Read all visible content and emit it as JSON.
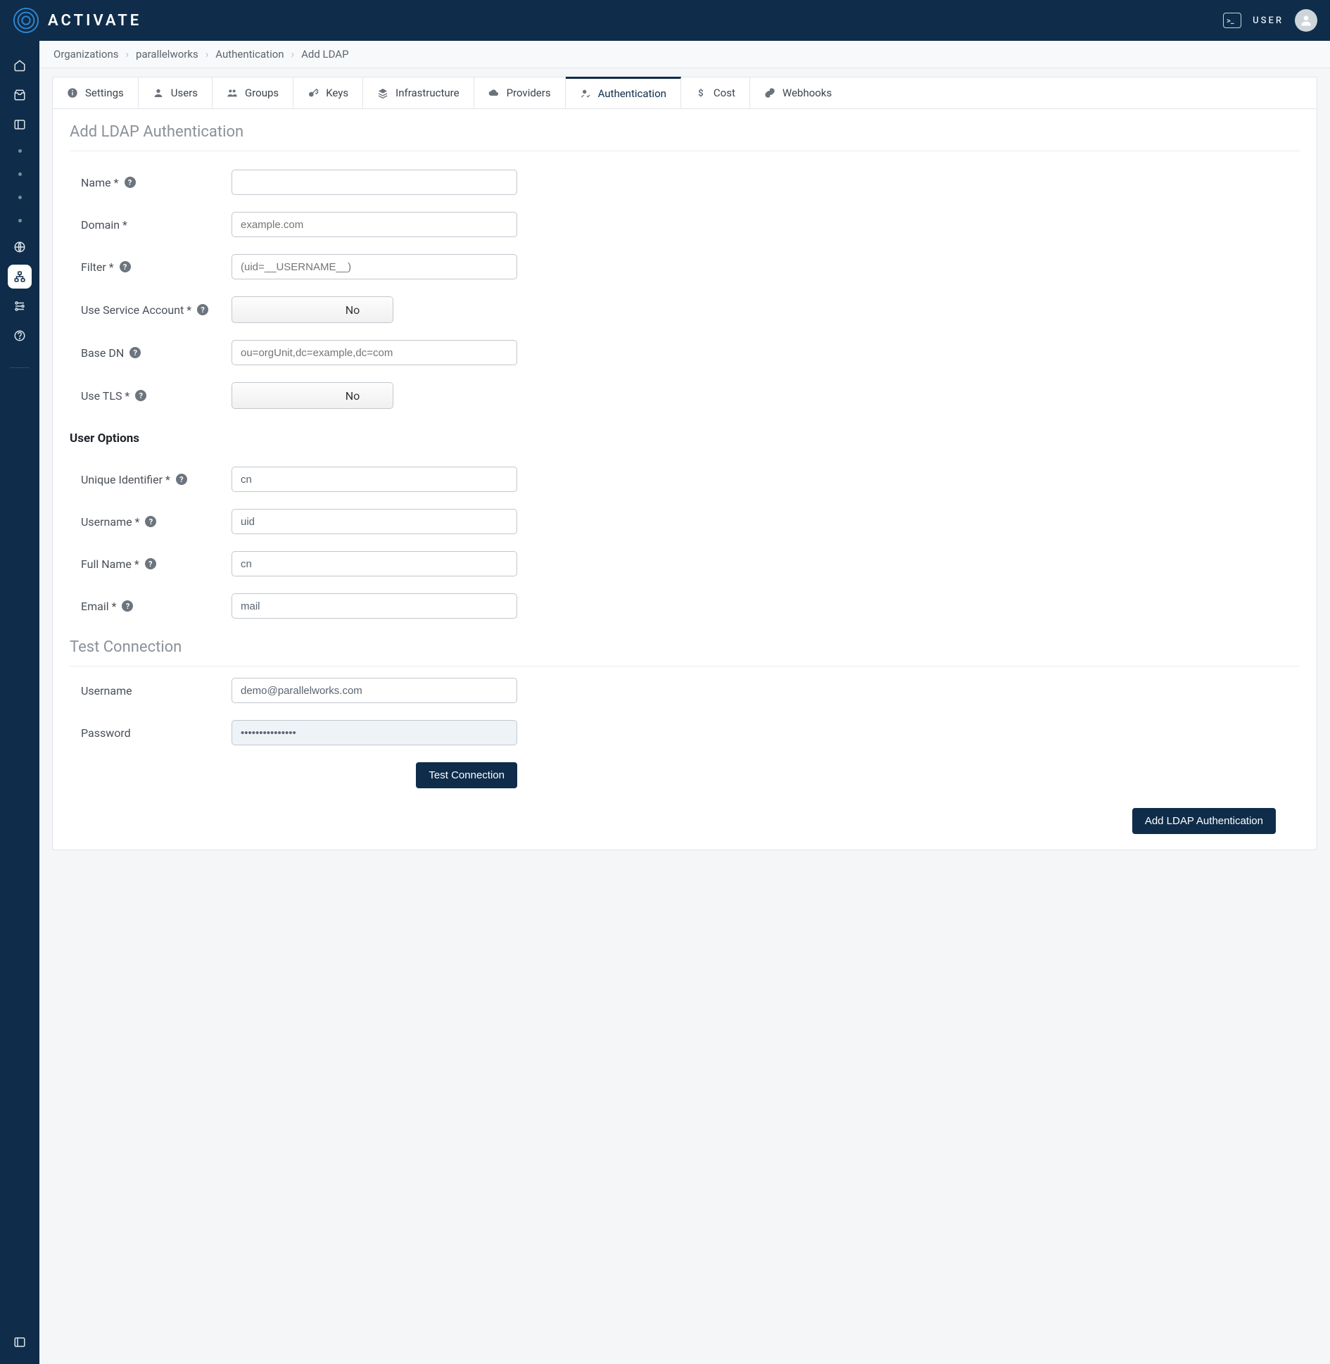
{
  "brand": {
    "name": "ACTIVATE"
  },
  "topbar": {
    "user_label": "USER"
  },
  "breadcrumb": [
    "Organizations",
    "parallelworks",
    "Authentication",
    "Add LDAP"
  ],
  "tabs": [
    {
      "label": "Settings",
      "icon": "info"
    },
    {
      "label": "Users",
      "icon": "user"
    },
    {
      "label": "Groups",
      "icon": "group"
    },
    {
      "label": "Keys",
      "icon": "key"
    },
    {
      "label": "Infrastructure",
      "icon": "layers"
    },
    {
      "label": "Providers",
      "icon": "cloud"
    },
    {
      "label": "Authentication",
      "icon": "user-auth",
      "active": true
    },
    {
      "label": "Cost",
      "icon": "dollar"
    },
    {
      "label": "Webhooks",
      "icon": "link"
    }
  ],
  "section": {
    "title": "Add LDAP Authentication",
    "fields": {
      "name": {
        "label": "Name *",
        "value": ""
      },
      "domain": {
        "label": "Domain *",
        "placeholder": "example.com"
      },
      "filter": {
        "label": "Filter *",
        "placeholder": "(uid=__USERNAME__)"
      },
      "use_service_account": {
        "label": "Use Service Account *",
        "value": "No"
      },
      "base_dn": {
        "label": "Base DN",
        "placeholder": "ou=orgUnit,dc=example,dc=com"
      },
      "use_tls": {
        "label": "Use TLS *",
        "value": "No"
      }
    },
    "user_options": {
      "heading": "User Options",
      "unique_identifier": {
        "label": "Unique Identifier *",
        "value": "cn"
      },
      "username": {
        "label": "Username *",
        "value": "uid"
      },
      "full_name": {
        "label": "Full Name *",
        "value": "cn"
      },
      "email": {
        "label": "Email *",
        "value": "mail"
      }
    },
    "test": {
      "heading": "Test Connection",
      "username": {
        "label": "Username",
        "value": "demo@parallelworks.com"
      },
      "password": {
        "label": "Password",
        "value": "•••••••••••••••"
      },
      "button": "Test Connection"
    },
    "submit": "Add LDAP Authentication"
  }
}
